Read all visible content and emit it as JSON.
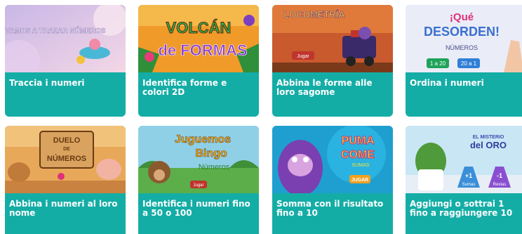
{
  "cards": [
    {
      "title": "Traccia i numeri",
      "art": "VAMOS A TRAZAR NÚMEROS"
    },
    {
      "title": "Identifica forme e colori 2D",
      "art_line1": "VOLCÁN",
      "art_line2": "de FORMAS"
    },
    {
      "title": "Abbina le forme alle loro sagome",
      "art": "LOCOMETRÍA",
      "button": "Jugar"
    },
    {
      "title": "Ordina i numeri",
      "art_line1": "¡Qué",
      "art_line2": "DESORDEN!",
      "art_line3": "NÚMEROS",
      "btn1": "1 a 20",
      "btn2": "20 a 1"
    },
    {
      "title": "Abbina i numeri al loro nome",
      "art_line1": "DUELO",
      "art_line2": "DE",
      "art_line3": "NÚMEROS"
    },
    {
      "title": "Identifica i numeri fino a 50 o 100",
      "art_line1": "Juguemos",
      "art_line2": "Bingo",
      "art_line3": "Números",
      "button": "Jugar"
    },
    {
      "title": "Somma con il risultato fino a 10",
      "art_line1": "PUMA",
      "art_line2": "COME",
      "art_line3": "SUMAS",
      "button": "JUGAR"
    },
    {
      "title": "Aggiungi o sottrai 1 fino a raggiungere 10",
      "art_line1": "EL MISTERIO",
      "art_line2": "del ORO",
      "flask1_sign": "+1",
      "flask1_label": "Sumas",
      "flask2_sign": "-1",
      "flask2_label": "Restas"
    }
  ]
}
